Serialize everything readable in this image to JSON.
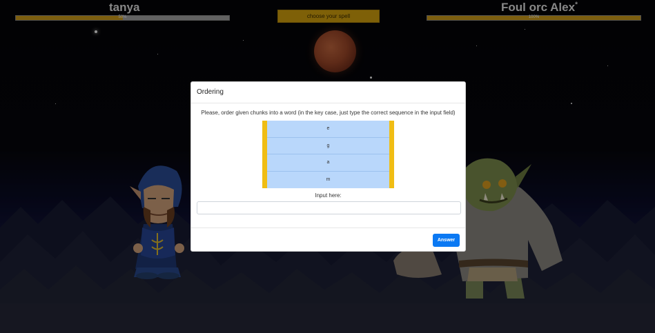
{
  "players": {
    "left": {
      "name": "tanya",
      "hp_text": "50%",
      "hp_fraction": 0.5
    },
    "right": {
      "name": "Foul orc Alex",
      "name_suffix": "*",
      "hp_text": "100%",
      "hp_fraction": 1.0
    }
  },
  "spell_button_label": "choose your spell",
  "modal": {
    "title": "Ordering",
    "instruction": "Please, order given chunks into a word (in the key case, just type the correct sequence in the input field)",
    "chunks": [
      "e",
      "g",
      "a",
      "m"
    ],
    "input_label": "Input here:",
    "input_value": "",
    "answer_label": "Answer"
  },
  "colors": {
    "hp_fill": "#d6a31a",
    "spell_button": "#d9a60f",
    "chunk_bg": "#b9d7fb",
    "chunk_border": "#f0bd14",
    "answer_button": "#0b79f3"
  },
  "icons": {
    "left_character": "wizard-character",
    "right_character": "orc-character",
    "moon": "blood-moon"
  }
}
